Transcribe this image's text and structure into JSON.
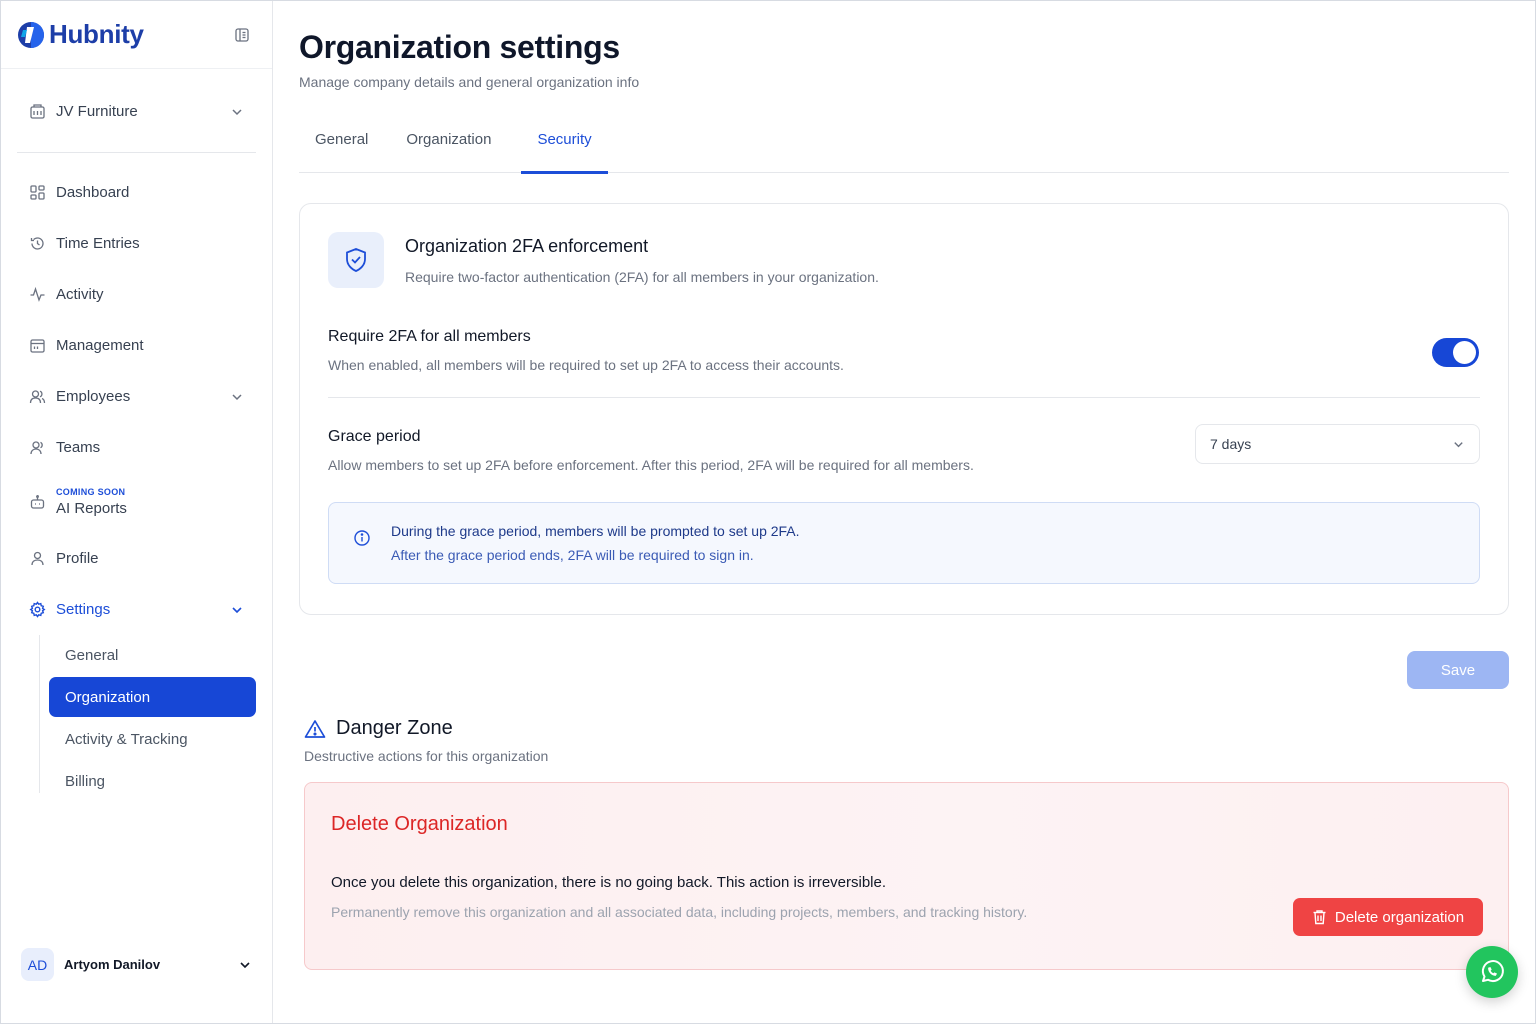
{
  "brand": {
    "name": "Hubnity",
    "logo_color": "#1d3ea8"
  },
  "org_switcher": {
    "name": "JV Furniture"
  },
  "nav": {
    "items": [
      {
        "label": "Dashboard",
        "icon": "grid-icon"
      },
      {
        "label": "Time Entries",
        "icon": "history-icon"
      },
      {
        "label": "Activity",
        "icon": "activity-icon"
      },
      {
        "label": "Management",
        "icon": "calendar-icon"
      },
      {
        "label": "Employees",
        "icon": "users-icon"
      },
      {
        "label": "Teams",
        "icon": "team-icon"
      },
      {
        "label": "AI Reports",
        "badge": "COMING SOON",
        "icon": "robot-icon"
      },
      {
        "label": "Profile",
        "icon": "user-icon"
      },
      {
        "label": "Settings",
        "icon": "gear-icon"
      }
    ],
    "settings_sub": [
      "General",
      "Organization",
      "Activity & Tracking",
      "Billing"
    ],
    "active_sub": "Organization"
  },
  "user": {
    "initials": "AD",
    "name": "Artyom Danilov"
  },
  "page": {
    "title": "Organization settings",
    "subtitle": "Manage company details and general organization info"
  },
  "tabs": [
    "General",
    "Organization",
    "Security"
  ],
  "active_tab": "Security",
  "twofa": {
    "title": "Organization 2FA enforcement",
    "description": "Require two-factor authentication (2FA) for all members in your organization.",
    "require_title": "Require 2FA for all members",
    "require_desc": "When enabled, all members will be required to set up 2FA to access their accounts.",
    "require_enabled": true,
    "grace_title": "Grace period",
    "grace_desc": "Allow members to set up 2FA before enforcement. After this period, 2FA will be required for all members.",
    "grace_value": "7 days",
    "info_title": "During the grace period, members will be prompted to set up 2FA.",
    "info_sub": "After the grace period ends, 2FA will be required to sign in."
  },
  "save_label": "Save",
  "danger": {
    "title": "Danger Zone",
    "subtitle": "Destructive actions for this organization",
    "card_title": "Delete Organization",
    "warning": "Once you delete this organization, there is no going back. This action is irreversible.",
    "description": "Permanently remove this organization and all associated data, including projects, members, and tracking history.",
    "button_label": "Delete organization"
  },
  "colors": {
    "accent": "#1747d6",
    "danger": "#ef4444",
    "whatsapp": "#22c55e"
  }
}
